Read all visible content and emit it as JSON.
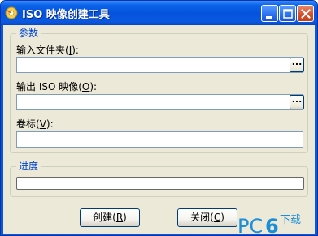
{
  "window": {
    "title": "ISO 映像创建工具"
  },
  "params_group": {
    "title": "参数",
    "input_folder": {
      "label": "输入文件夹",
      "mnemonic": "I",
      "value": "",
      "browse_label": "..."
    },
    "output_iso": {
      "label": "输出 ISO 映像",
      "mnemonic": "O",
      "value": "",
      "browse_label": "..."
    },
    "volume_label": {
      "label": "卷标",
      "mnemonic": "V",
      "value": ""
    }
  },
  "progress_group": {
    "title": "进度",
    "progress_value": 0
  },
  "buttons": {
    "create": {
      "label": "创建",
      "mnemonic": "R"
    },
    "close": {
      "label": "关闭",
      "mnemonic": "C"
    }
  },
  "watermark": {
    "text_pc": "PC",
    "text_6": "6",
    "text_download": "下载"
  },
  "colors": {
    "titlebar": "#0a59e0",
    "group_title": "#0046d5",
    "client_bg": "#ece9d8",
    "watermark_blue": "#1a8fd8"
  }
}
